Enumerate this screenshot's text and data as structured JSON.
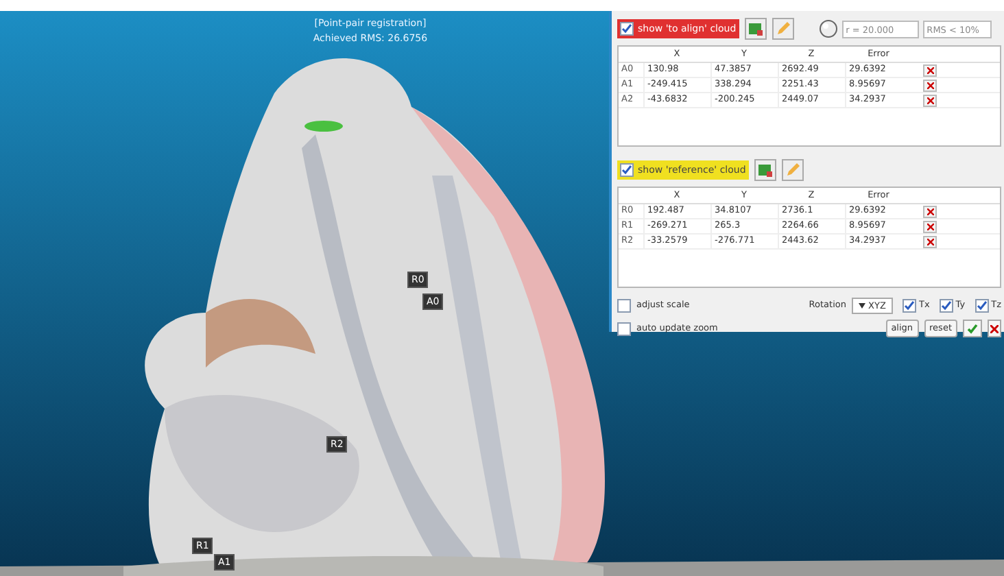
{
  "view": {
    "title": "[Point-pair registration]",
    "status": "Achieved RMS: 26.6756",
    "markers": [
      {
        "label": "R0"
      },
      {
        "label": "A0"
      },
      {
        "label": "R2"
      },
      {
        "label": "R1"
      },
      {
        "label": "A1"
      }
    ]
  },
  "align_group": {
    "show_label": "show 'to align' cloud",
    "checked": true,
    "color": "#e03030",
    "radius": "r = 20.000",
    "rms": "RMS < 10%",
    "columns": [
      "X",
      "Y",
      "Z",
      "Error"
    ],
    "rows": [
      {
        "name": "A0",
        "cells": [
          "130.98",
          "47.3857",
          "2692.49",
          "29.6392"
        ]
      },
      {
        "name": "A1",
        "cells": [
          "-249.415",
          "338.294",
          "2251.43",
          "8.95697"
        ]
      },
      {
        "name": "A2",
        "cells": [
          "-43.6832",
          "-200.245",
          "2449.07",
          "34.2937"
        ]
      }
    ]
  },
  "reference_group": {
    "show_label": "show 'reference' cloud",
    "checked": true,
    "color": "#f0e020",
    "columns": [
      "X",
      "Y",
      "Z",
      "Error"
    ],
    "rows": [
      {
        "name": "R0",
        "cells": [
          "192.487",
          "34.8107",
          "2736.1",
          "29.6392"
        ]
      },
      {
        "name": "R1",
        "cells": [
          "-269.271",
          "265.3",
          "2264.66",
          "8.95697"
        ]
      },
      {
        "name": "R2",
        "cells": [
          "-33.2579",
          "-276.771",
          "2443.62",
          "34.2937"
        ]
      }
    ]
  },
  "options": {
    "adjust_scale": {
      "label": "adjust scale",
      "checked": false
    },
    "auto_zoom": {
      "label": "auto update zoom",
      "checked": false
    },
    "rotation_label": "Rotation",
    "rotation": "XYZ",
    "translations": [
      {
        "label": "Tx",
        "checked": true
      },
      {
        "label": "Ty",
        "checked": true
      },
      {
        "label": "Tz",
        "checked": true
      }
    ],
    "buttons": [
      "align",
      "reset"
    ]
  }
}
